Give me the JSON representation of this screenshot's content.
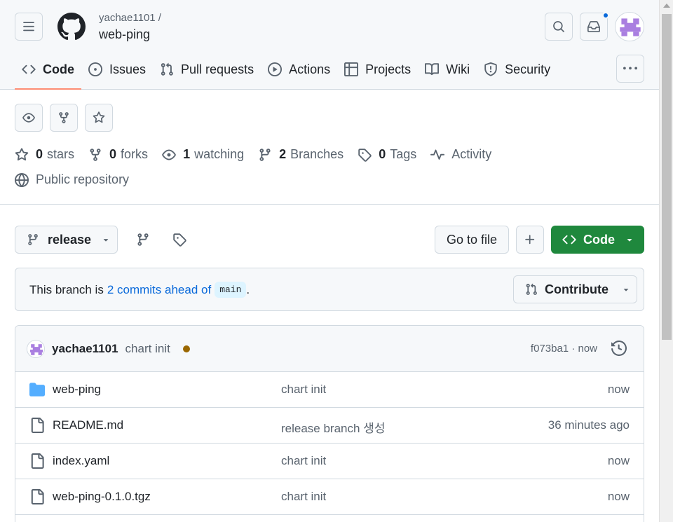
{
  "header": {
    "owner": "yachae1101 /",
    "repo": "web-ping",
    "colors": {
      "accent_underline": "#fd8c73",
      "notification_dot": "#0969da"
    }
  },
  "nav": {
    "tabs": [
      {
        "label": "Code",
        "icon": "code-icon",
        "selected": true
      },
      {
        "label": "Issues",
        "icon": "issue-icon",
        "selected": false
      },
      {
        "label": "Pull requests",
        "icon": "pull-request-icon",
        "selected": false
      },
      {
        "label": "Actions",
        "icon": "play-icon",
        "selected": false
      },
      {
        "label": "Projects",
        "icon": "table-icon",
        "selected": false
      },
      {
        "label": "Wiki",
        "icon": "book-icon",
        "selected": false
      },
      {
        "label": "Security",
        "icon": "shield-icon",
        "selected": false
      }
    ]
  },
  "stats": {
    "stars_count": "0",
    "stars_label": "stars",
    "forks_count": "0",
    "forks_label": "forks",
    "watching_count": "1",
    "watching_label": "watching",
    "branches_count": "2",
    "branches_label": "Branches",
    "tags_count": "0",
    "tags_label": "Tags",
    "activity_label": "Activity",
    "visibility": "Public repository"
  },
  "toolbar": {
    "branch": "release",
    "goto_file": "Go to file",
    "code_label": "Code",
    "code_color": "#1f883d"
  },
  "banner": {
    "prefix": "This branch is",
    "link": "2 commits ahead of",
    "base": "main",
    "suffix": ".",
    "contribute_label": "Contribute"
  },
  "latest_commit": {
    "author": "yachae1101",
    "message": "chart init",
    "status_color": "#9a6700",
    "hash_time": "f073ba1 · now"
  },
  "files": [
    {
      "type": "folder",
      "icon": "folder-icon",
      "name": "web-ping",
      "message": "chart init",
      "time": "now"
    },
    {
      "type": "file",
      "icon": "file-icon",
      "name": "README.md",
      "message": "release branch 생성",
      "time": "36 minutes ago"
    },
    {
      "type": "file",
      "icon": "file-icon",
      "name": "index.yaml",
      "message": "chart init",
      "time": "now"
    },
    {
      "type": "file",
      "icon": "file-icon",
      "name": "web-ping-0.1.0.tgz",
      "message": "chart init",
      "time": "now"
    }
  ]
}
